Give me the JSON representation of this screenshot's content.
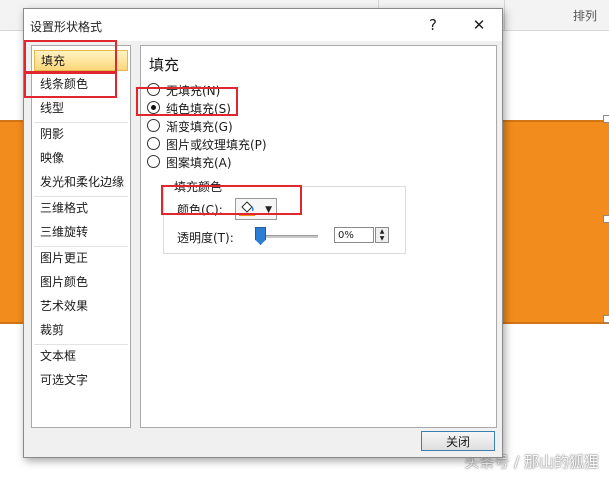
{
  "background": {
    "ribbon_right_label": "排列",
    "watermark": "头条号 / 那山的狐狸",
    "shape_color": "#f28c1c"
  },
  "dialog": {
    "title": "设置形状格式",
    "help_label": "?",
    "close_label": "✕",
    "close_button_label": "关闭"
  },
  "nav": {
    "items": [
      {
        "label": "填充"
      },
      {
        "label": "线条颜色"
      },
      {
        "label": "线型"
      },
      {
        "label": "阴影"
      },
      {
        "label": "映像"
      },
      {
        "label": "发光和柔化边缘"
      },
      {
        "label": "三维格式"
      },
      {
        "label": "三维旋转"
      },
      {
        "label": "图片更正"
      },
      {
        "label": "图片颜色"
      },
      {
        "label": "艺术效果"
      },
      {
        "label": "裁剪"
      },
      {
        "label": "文本框"
      },
      {
        "label": "可选文字"
      }
    ],
    "selected": "填充"
  },
  "fill": {
    "section_title": "填充",
    "options": [
      {
        "label": "无填充(N)"
      },
      {
        "label": "纯色填充(S)"
      },
      {
        "label": "渐变填充(G)"
      },
      {
        "label": "图片或纹理填充(P)"
      },
      {
        "label": "图案填充(A)"
      }
    ],
    "selected": "纯色填充(S)",
    "group_title": "填充颜色",
    "color_label": "颜色(C):",
    "current_color": "#f28c1c",
    "transparency_label": "透明度(T):",
    "transparency_value": "0%",
    "transparency_fraction": 0
  },
  "colors": {
    "highlight": "#e0262e",
    "selected_nav": "#fcd77a",
    "accent": "#2a7fd4"
  }
}
